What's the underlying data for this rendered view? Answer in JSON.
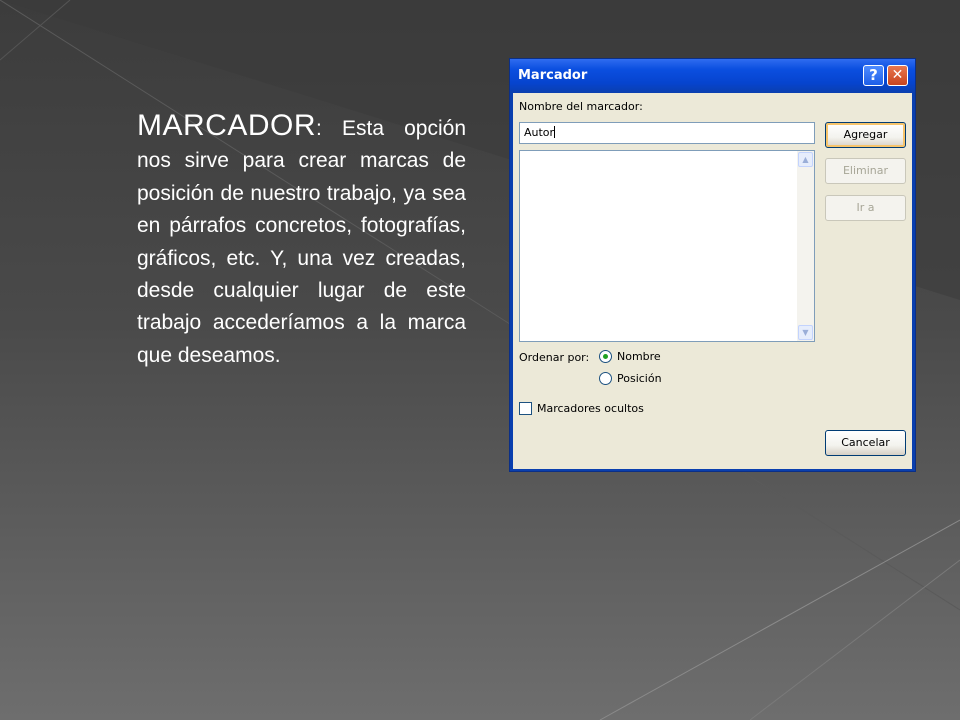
{
  "slide": {
    "heading": "MARCADOR",
    "colon": ":",
    "body": " Esta opción nos sirve para crear marcas de posición de nuestro trabajo, ya sea en párrafos concretos, fotografías, gráficos, etc. Y, una vez creadas, desde cualquier lugar de este trabajo accederíamos a la marca que deseamos."
  },
  "dialog": {
    "title": "Marcador",
    "help_glyph": "?",
    "close_glyph": "✕",
    "name_label": "Nombre del marcador:",
    "name_value": "Autor",
    "buttons": {
      "add": "Agregar",
      "delete": "Eliminar",
      "goto": "Ir a",
      "cancel": "Cancelar"
    },
    "sort_label": "Ordenar por:",
    "sort_options": [
      {
        "label": "Nombre",
        "selected": true
      },
      {
        "label": "Posición",
        "selected": false
      }
    ],
    "hidden_bookmarks_label": "Marcadores ocultos",
    "hidden_bookmarks_checked": false
  },
  "colors": {
    "titlebar": "#0b4fe0",
    "dialog_face": "#ece9d8",
    "radio_selected": "#21a121"
  },
  "icons": [
    "help-icon",
    "close-icon",
    "scroll-up-icon",
    "scroll-down-icon"
  ]
}
